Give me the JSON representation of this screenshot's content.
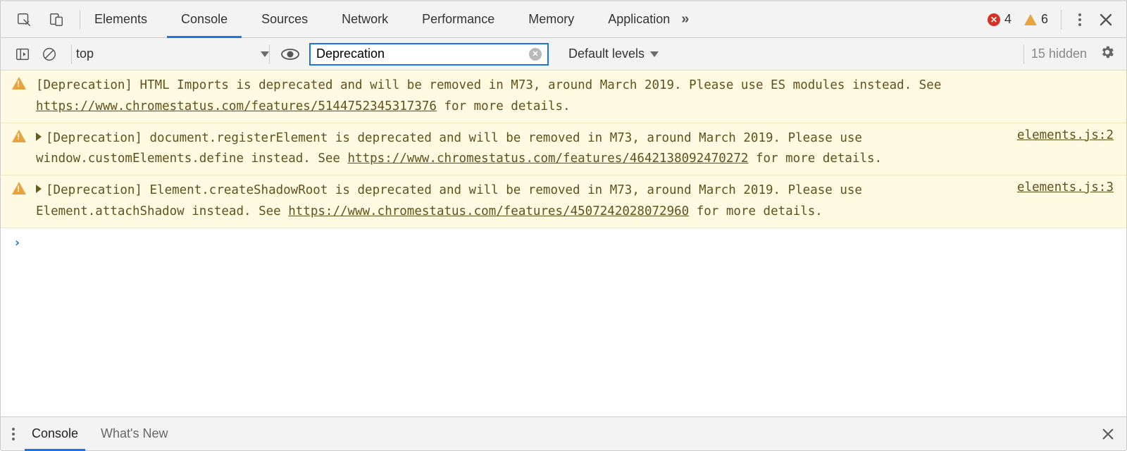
{
  "tabs": {
    "items": [
      "Elements",
      "Console",
      "Sources",
      "Network",
      "Performance",
      "Memory",
      "Application"
    ],
    "active": "Console",
    "overflow_glyph": "»"
  },
  "status": {
    "errors": "4",
    "warnings": "6"
  },
  "toolbar": {
    "context": "top",
    "filter_value": "Deprecation",
    "levels_label": "Default levels",
    "hidden_label": "15 hidden"
  },
  "messages": [
    {
      "level": "warn",
      "expandable": false,
      "text_pre": "[Deprecation] HTML Imports is deprecated and will be removed in M73, around March 2019. Please use ES modules instead. See ",
      "link": "https://www.chromestatus.com/features/5144752345317376",
      "text_post": " for more details.",
      "source": ""
    },
    {
      "level": "warn",
      "expandable": true,
      "text_pre": "[Deprecation] document.registerElement is deprecated and will be removed in M73, around March 2019. Please use window.customElements.define instead. See ",
      "link": "https://www.chromestatus.com/features/4642138092470272",
      "text_post": " for more details.",
      "source": "elements.js:2"
    },
    {
      "level": "warn",
      "expandable": true,
      "text_pre": "[Deprecation] Element.createShadowRoot is deprecated and will be removed in M73, around March 2019. Please use Element.attachShadow instead. See ",
      "link": "https://www.chromestatus.com/features/4507242028072960",
      "text_post": " for more details.",
      "source": "elements.js:3"
    }
  ],
  "prompt_glyph": "›",
  "drawer": {
    "tabs": [
      "Console",
      "What's New"
    ],
    "active": "Console"
  }
}
